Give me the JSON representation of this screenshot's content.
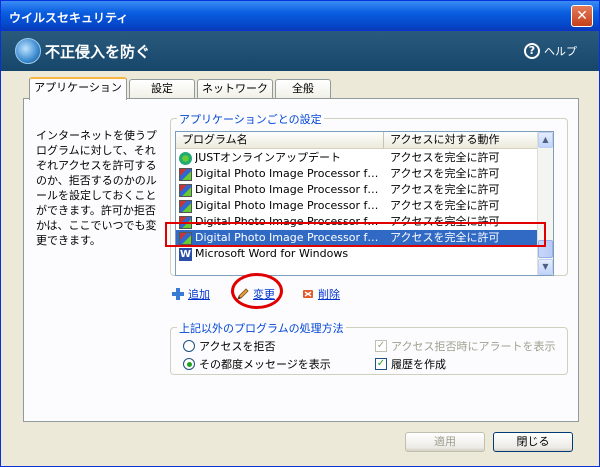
{
  "window": {
    "title": "ウイルスセキュリティ",
    "close_glyph": "✕"
  },
  "header": {
    "title": "不正侵入を防ぐ",
    "help_label": "ヘルプ",
    "help_glyph": "?"
  },
  "tabs": [
    {
      "label": "アプリケーション",
      "active": true
    },
    {
      "label": "設定",
      "active": false
    },
    {
      "label": "ネットワーク",
      "active": false
    },
    {
      "label": "全般",
      "active": false
    }
  ],
  "description": "インターネットを使うプログラムに対して、それぞれアクセスを許可するのか、拒否するのかのルールを設定しておくことができます。許可か拒否かは、ここでいつでも変更できます。",
  "app_settings": {
    "legend": "アプリケーションごとの設定",
    "columns": [
      "プログラム名",
      "アクセスに対する動作"
    ],
    "rows": [
      {
        "icon": "just-icon",
        "name": "JUSTオンラインアップデート",
        "access": "アクセスを完全に許可",
        "selected": false
      },
      {
        "icon": "photo-icon",
        "name": "Digital Photo Image Processor for Int...",
        "access": "アクセスを完全に許可",
        "selected": false
      },
      {
        "icon": "photo-icon",
        "name": "Digital Photo Image Processor for Int...",
        "access": "アクセスを完全に許可",
        "selected": false
      },
      {
        "icon": "photo-icon",
        "name": "Digital Photo Image Processor for Int...",
        "access": "アクセスを完全に許可",
        "selected": false
      },
      {
        "icon": "photo-icon",
        "name": "Digital Photo Image Processor for Int...",
        "access": "アクセスを完全に許可",
        "selected": false
      },
      {
        "icon": "photo-icon",
        "name": "Digital Photo Image Processor for Int...",
        "access": "アクセスを完全に許可",
        "selected": true
      },
      {
        "icon": "word-icon",
        "name": "Microsoft Word for Windows",
        "access": "",
        "selected": false
      }
    ]
  },
  "actions": {
    "add": "追加",
    "change": "変更",
    "delete": "削除"
  },
  "other_programs": {
    "legend": "上記以外のプログラムの処理方法",
    "deny_label": "アクセスを拒否",
    "prompt_label": "その都度メッセージを表示",
    "alert_label": "アクセス拒否時にアラートを表示",
    "history_label": "履歴を作成",
    "selected_option": "prompt",
    "alert_checked": true,
    "history_checked": true
  },
  "buttons": {
    "apply": "適用",
    "close": "閉じる"
  },
  "colors": {
    "selection": "#316ac5",
    "highlight_red": "#e00000",
    "link_blue": "#0033cc",
    "legend_blue": "#0046d5"
  }
}
